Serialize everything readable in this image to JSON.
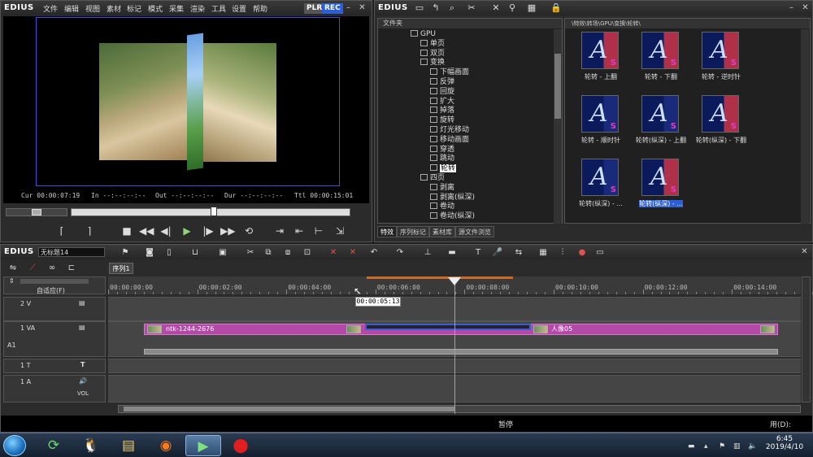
{
  "app": {
    "logo": "EDIUS"
  },
  "player": {
    "menu": [
      "文件",
      "编辑",
      "视图",
      "素材",
      "标记",
      "模式",
      "采集",
      "渲染",
      "工具",
      "设置",
      "帮助"
    ],
    "plr_label": "PLR",
    "rec_label": "REC",
    "timecodes": {
      "cur": "Cur 00:00:07:19",
      "in": "In --:--:--:--",
      "out": "Out --:--:--:--",
      "dur": "Dur --:--:--:--",
      "ttl": "Ttl 00:00:15:01"
    }
  },
  "library": {
    "folder_header": "文件夹",
    "path": "\\特效\\转场\\GPU\\变换\\轮转\\",
    "tree": [
      {
        "label": "GPU",
        "level": 0
      },
      {
        "label": "单页",
        "level": 1
      },
      {
        "label": "双页",
        "level": 1
      },
      {
        "label": "变换",
        "level": 1
      },
      {
        "label": "下幅画面",
        "level": 2
      },
      {
        "label": "反弹",
        "level": 2
      },
      {
        "label": "回旋",
        "level": 2
      },
      {
        "label": "扩大",
        "level": 2
      },
      {
        "label": "掉落",
        "level": 2
      },
      {
        "label": "旋转",
        "level": 2
      },
      {
        "label": "灯光移动",
        "level": 2
      },
      {
        "label": "移动画面",
        "level": 2
      },
      {
        "label": "穿透",
        "level": 2
      },
      {
        "label": "跳动",
        "level": 2
      },
      {
        "label": "轮转",
        "level": 2,
        "selected": true
      },
      {
        "label": "四页",
        "level": 1
      },
      {
        "label": "剥离",
        "level": 2
      },
      {
        "label": "剥离(纵深)",
        "level": 2
      },
      {
        "label": "卷动",
        "level": 2
      },
      {
        "label": "卷动(纵深)",
        "level": 2
      }
    ],
    "effects": [
      {
        "label": "轮转 - 上翻"
      },
      {
        "label": "轮转 - 下翻"
      },
      {
        "label": "轮转 - 逆时针"
      },
      {
        "label": "轮转 - 顺时针"
      },
      {
        "label": "轮转(纵深) - 上翻"
      },
      {
        "label": "轮转(纵深) - 下翻"
      },
      {
        "label": "轮转(纵深) - ..."
      },
      {
        "label": "轮转(纵深) - ...",
        "selected": true
      }
    ],
    "tabs": [
      "特效",
      "序列标记",
      "素材库",
      "源文件浏览"
    ]
  },
  "timeline": {
    "sequence_name": "无标题14",
    "sequence_tab": "序列1",
    "auto_label": "自适应(F)",
    "ruler": [
      "00:00:00:00",
      "00:00:02:00",
      "00:00:04:00",
      "00:00:06:00",
      "00:00:08:00",
      "00:00:10:00",
      "00:00:12:00",
      "00:00:14:00"
    ],
    "hover_timecode": "00:00:05:13",
    "tracks": {
      "v2": "2 V",
      "va1": "1 VA",
      "t1": "1 T",
      "a1": "1 A",
      "vol": "VOL"
    },
    "clips": {
      "clip1": "ntk-1244-2676",
      "clip2": "人像05"
    },
    "status": {
      "state": "暂停",
      "right": "用(D):"
    }
  },
  "taskbar": {
    "time": "6:45",
    "date": "2019/4/10"
  }
}
